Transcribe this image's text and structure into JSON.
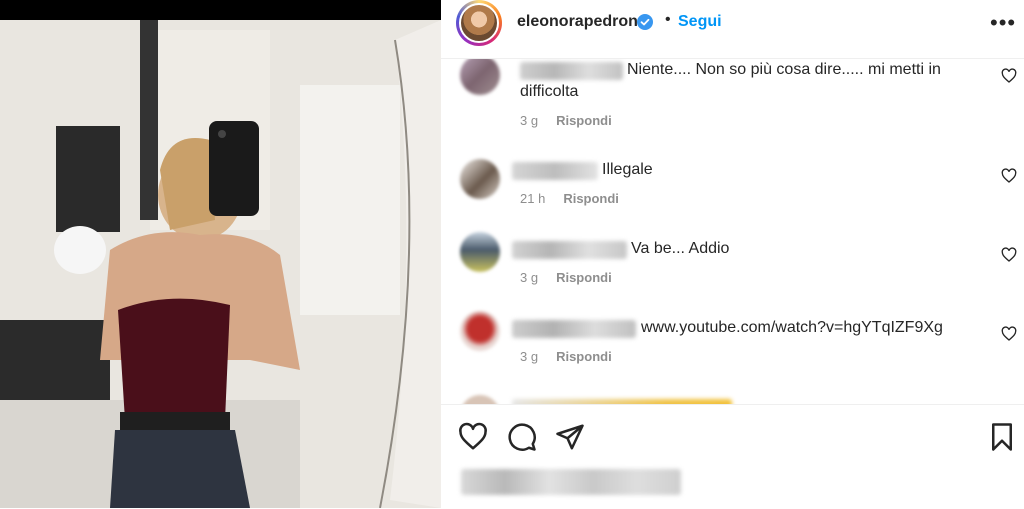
{
  "header": {
    "username": "eleonorapedron",
    "separator": "•",
    "follow_label": "Segui",
    "more_label": "•••"
  },
  "comments": [
    {
      "text_line1": "Niente.... Non so più cosa dire..... mi metti in",
      "text_line2": "difficolta",
      "time": "3 g",
      "reply_label": "Rispondi"
    },
    {
      "text": "Illegale",
      "time": "21 h",
      "reply_label": "Rispondi"
    },
    {
      "text": "Va be... Addio",
      "time": "3 g",
      "reply_label": "Rispondi"
    },
    {
      "text": "www.youtube.com/watch?v=hgYTqIZF9Xg",
      "time": "3 g",
      "reply_label": "Rispondi"
    }
  ],
  "icons": {
    "like": "heart-icon",
    "comment": "comment-icon",
    "share": "share-icon",
    "save": "bookmark-icon",
    "verified": "verified-badge-icon",
    "comment_like": "heart-icon"
  },
  "colors": {
    "accent": "#0095f6",
    "text": "#262626",
    "secondary": "#8e8e8e"
  }
}
